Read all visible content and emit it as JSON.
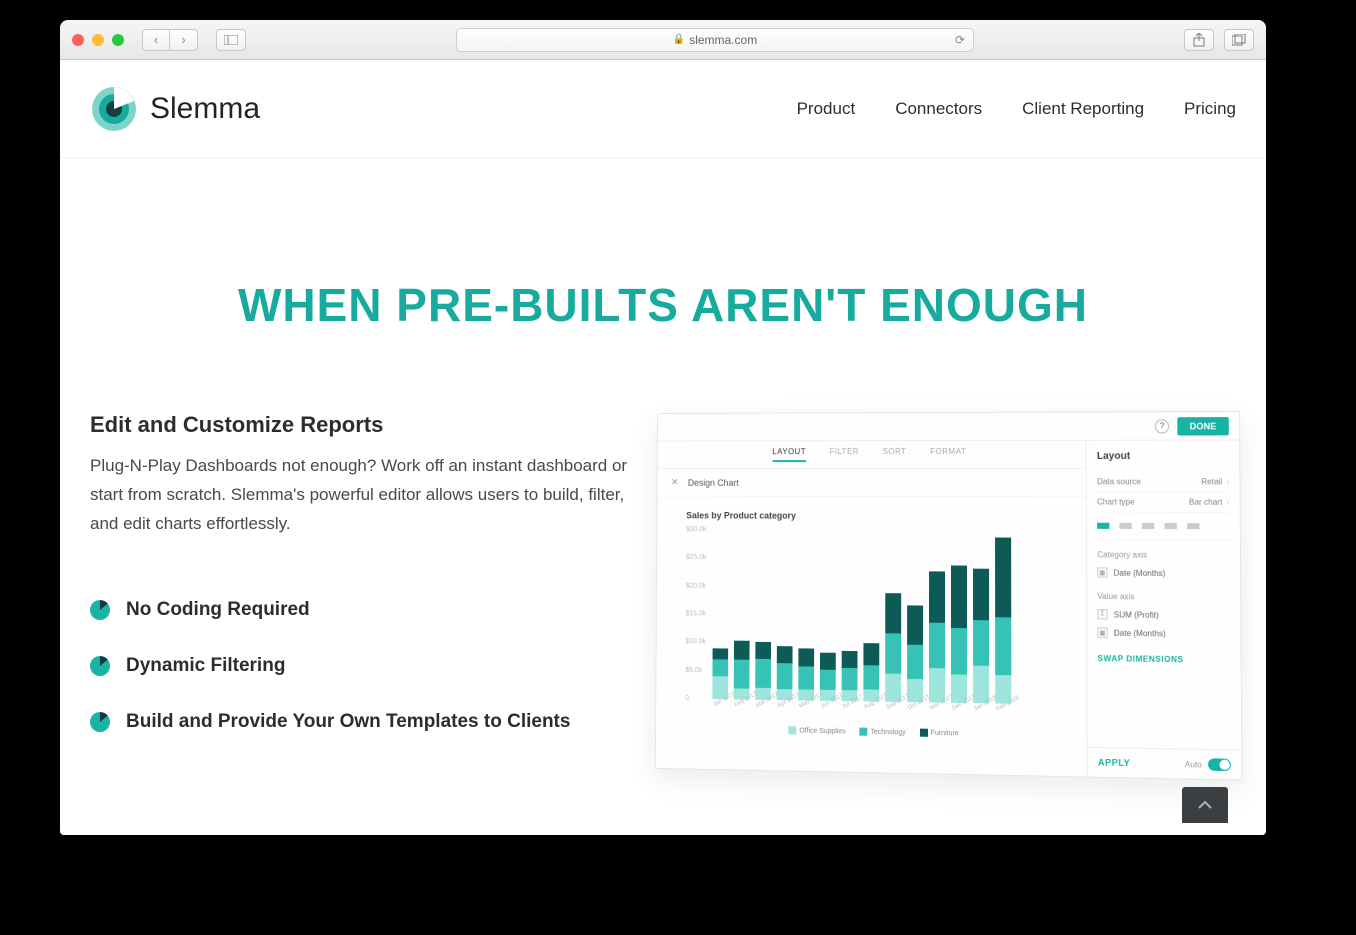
{
  "browser": {
    "domain": "slemma.com",
    "addtab": "+"
  },
  "header": {
    "brand": "Slemma",
    "nav": [
      "Product",
      "Connectors",
      "Client Reporting",
      "Pricing"
    ]
  },
  "hero": {
    "title": "WHEN PRE-BUILTS AREN'T ENOUGH"
  },
  "section": {
    "title": "Edit and Customize Reports",
    "body": "Plug-N-Play Dashboards not enough? Work off an instant dashboard or start from scratch. Slemma's powerful editor allows users to build, filter, and edit charts effortlessly.",
    "bullets": [
      "No Coding Required",
      "Dynamic Filtering",
      "Build and Provide Your Own Templates to Clients"
    ]
  },
  "editor": {
    "help": "?",
    "done": "DONE",
    "tabs": [
      "LAYOUT",
      "FILTER",
      "SORT",
      "FORMAT"
    ],
    "close": "✕",
    "panel_title": "Design Chart",
    "chart_title": "Sales by Product category",
    "side": {
      "heading": "Layout",
      "data_source_label": "Data source",
      "data_source_value": "Retail",
      "chart_type_label": "Chart type",
      "chart_type_value": "Bar chart",
      "category_axis": "Category axis",
      "category_field": "Date (Months)",
      "value_axis": "Value axis",
      "value_field1": "SUM (Profit)",
      "value_field2": "Date (Months)",
      "swap": "SWAP DIMENSIONS",
      "apply": "APPLY",
      "auto": "Auto"
    }
  },
  "chart_data": {
    "type": "bar",
    "stacked": true,
    "title": "Sales by Product category",
    "xlabel": "",
    "ylabel": "",
    "ylim": [
      0,
      30
    ],
    "y_ticks": [
      "$30.0k",
      "$25.0k",
      "$20.0k",
      "$15.0k",
      "$10.0k",
      "$5.0k",
      "0"
    ],
    "categories": [
      "Jan 2017",
      "Feb 2017",
      "Mar 2017",
      "Apr 2017",
      "May 2017",
      "Jun 2017",
      "Jul 2017",
      "Aug 2017",
      "Sep 2017",
      "Oct 2017",
      "Nov 2017",
      "Dec 2017",
      "Jan 2018",
      "Feb 2018"
    ],
    "series": [
      {
        "name": "Office Supplies",
        "color": "#9ee6dd",
        "values": [
          4,
          2,
          2.2,
          2,
          2,
          2,
          2,
          2.2,
          5,
          4,
          6,
          5,
          6.5,
          5
        ]
      },
      {
        "name": "Technology",
        "color": "#36c3b5",
        "values": [
          3,
          5,
          5,
          4.5,
          4,
          3.5,
          3.8,
          4.2,
          7,
          6,
          8,
          8,
          8,
          10
        ]
      },
      {
        "name": "Furniture",
        "color": "#0d5a57",
        "values": [
          2,
          3.5,
          3,
          3,
          3.2,
          3,
          3,
          3.8,
          7,
          7,
          9,
          11,
          9,
          14
        ]
      }
    ],
    "legend": [
      "Office Supplies",
      "Technology",
      "Furniture"
    ]
  }
}
